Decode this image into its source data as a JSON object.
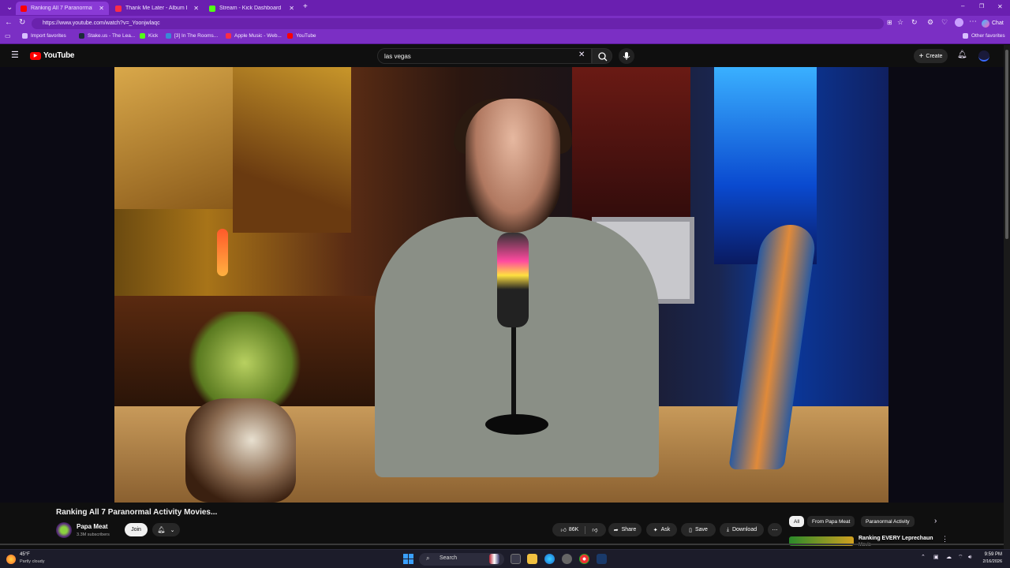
{
  "browser": {
    "tabs": [
      {
        "title": "Ranking All 7 Paranormal Acti",
        "color": "#ff0000",
        "active": true
      },
      {
        "title": "Thank Me Later - Album by Drake",
        "color": "#fa2d48",
        "active": false
      },
      {
        "title": "Stream - Kick Dashboard",
        "color": "#53fc18",
        "active": false
      }
    ],
    "url": "https://www.youtube.com/watch?v=_Yoonjwlaqc",
    "bookmarks": [
      {
        "label": "Import favorites",
        "color": "#d8c0ff"
      },
      {
        "label": "Stake.us - The Lea...",
        "color": "#1a2c38"
      },
      {
        "label": "Kick",
        "color": "#53fc18"
      },
      {
        "label": "[3] In The Rooms...",
        "color": "#3a8ad6"
      },
      {
        "label": "Apple Music - Web...",
        "color": "#fa2d48"
      },
      {
        "label": "YouTube",
        "color": "#ff0000"
      }
    ],
    "other_favorites": "Other favorites",
    "chat": "Chat"
  },
  "youtube": {
    "logo_text": "YouTube",
    "search_value": "las vegas",
    "create_label": "Create"
  },
  "video": {
    "title": "Ranking All 7 Paranormal Activity Movies...",
    "channel": "Papa Meat",
    "subscribers": "3.3M subscribers",
    "join_label": "Join",
    "likes": "86K",
    "share_label": "Share",
    "ask_label": "Ask",
    "save_label": "Save",
    "download_label": "Download",
    "progress": 0.0
  },
  "sidebar": {
    "chips": [
      "All",
      "From Papa Meat",
      "Paranormal Activity"
    ],
    "related_title": "Ranking EVERY Leprechaun",
    "related_title_2": "Movie"
  },
  "taskbar": {
    "weather_temp": "45°F",
    "weather_desc": "Partly cloudy",
    "search_label": "Search",
    "time": "9:59 PM",
    "date": "2/16/2026"
  }
}
